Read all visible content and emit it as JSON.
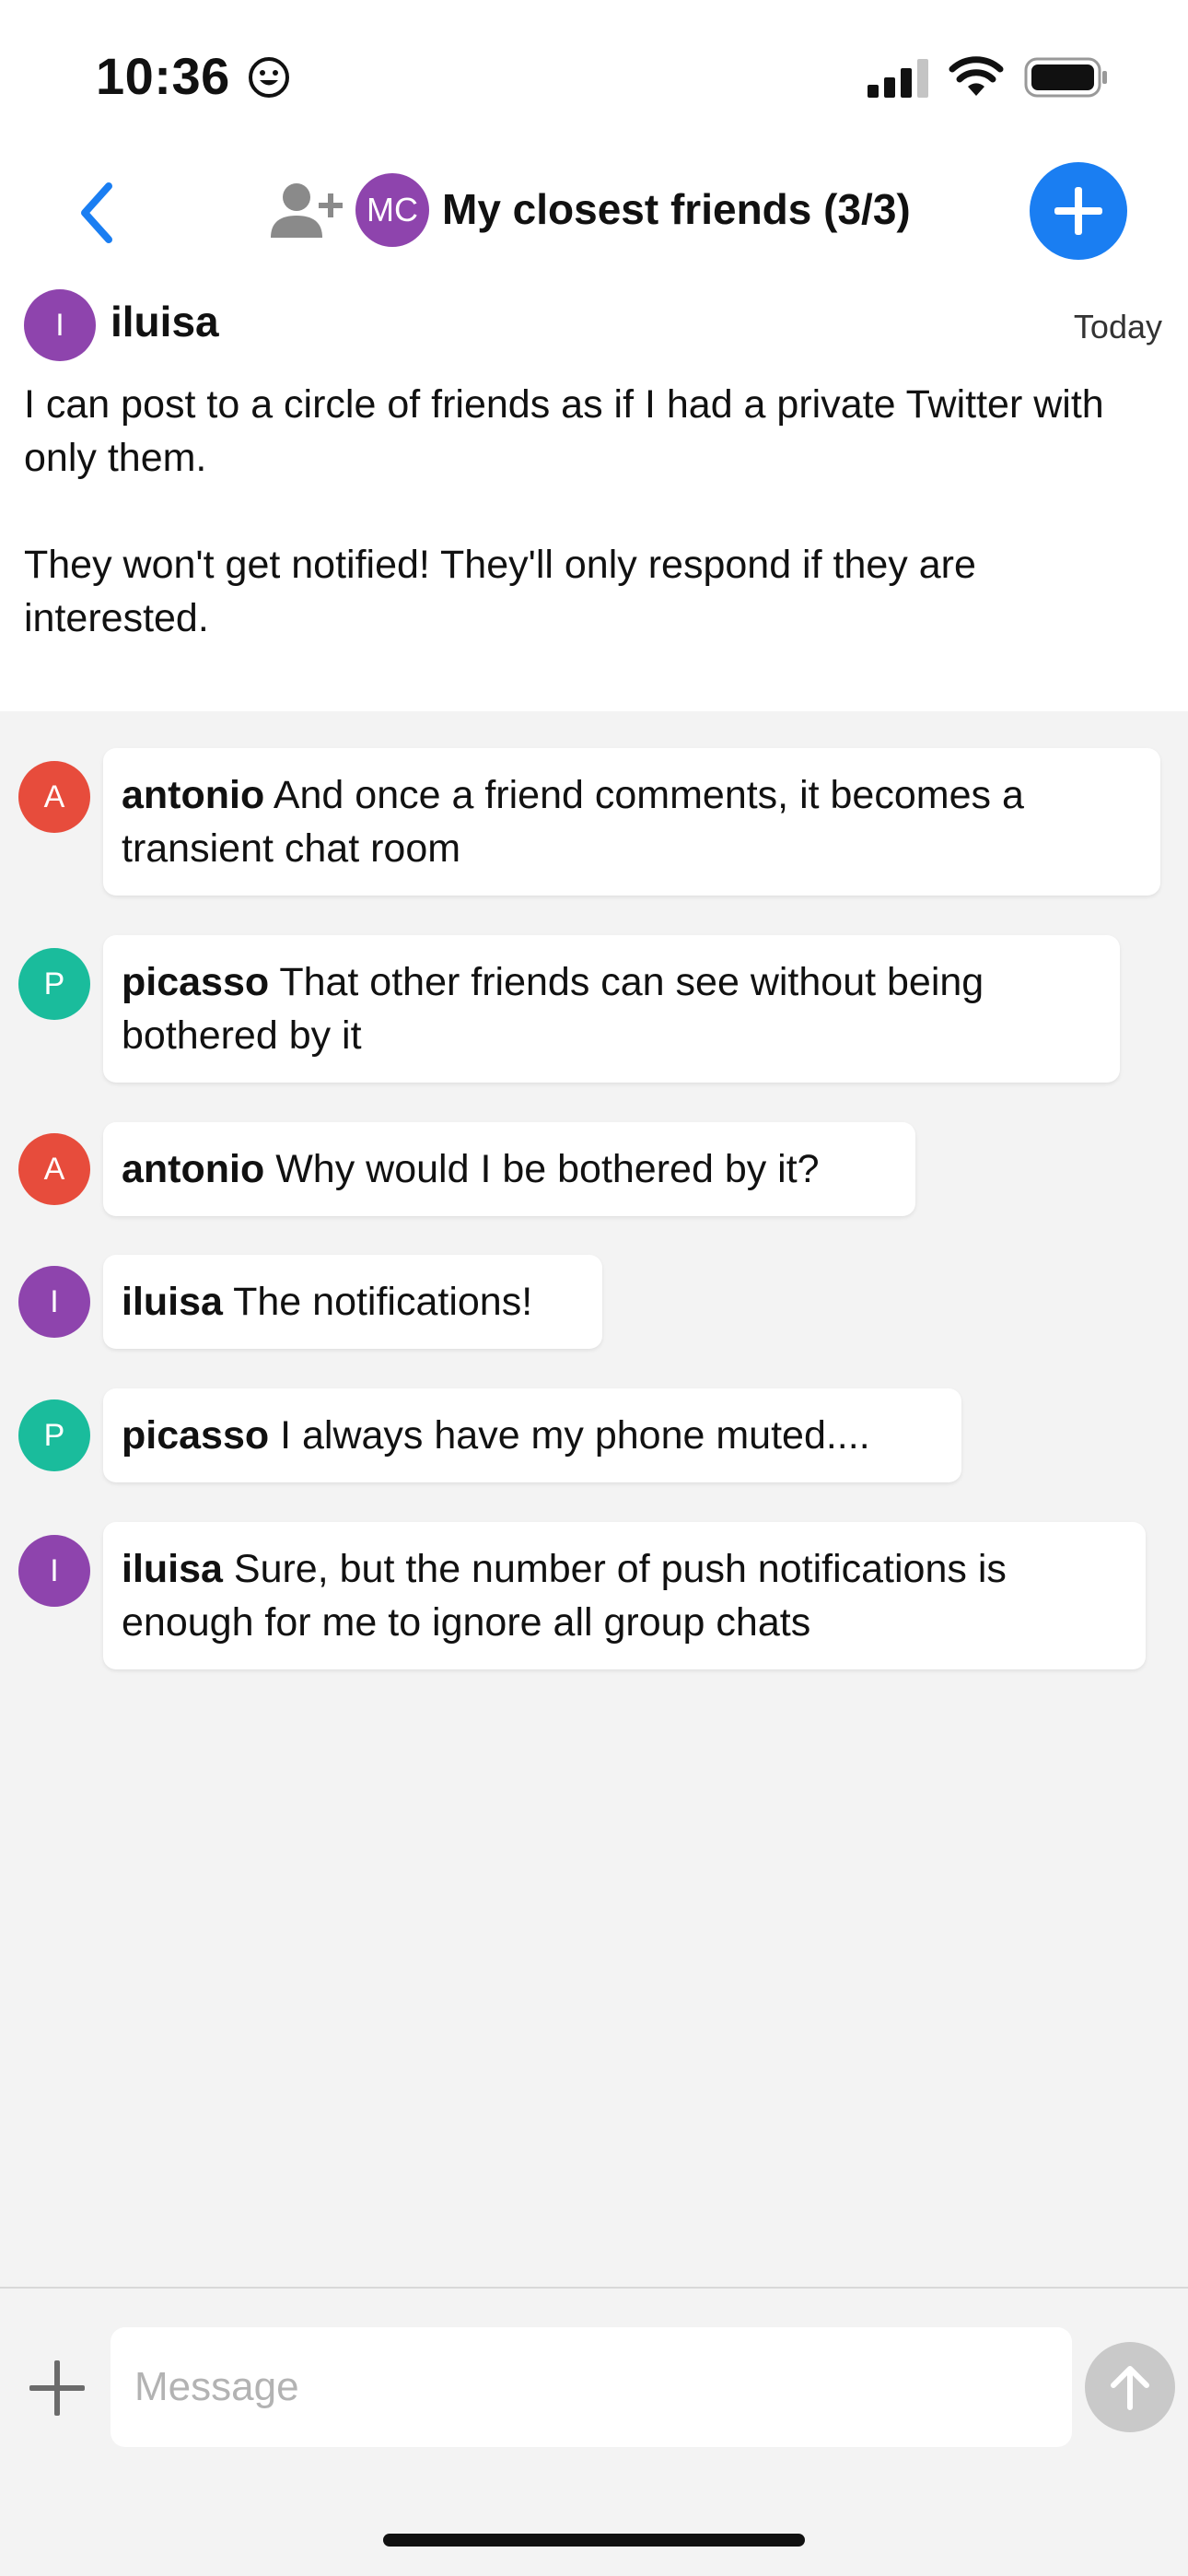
{
  "status_bar": {
    "time": "10:36"
  },
  "header": {
    "group_initials": "MC",
    "title": "My closest friends (3/3)"
  },
  "post": {
    "avatar_initial": "I",
    "author": "iluisa",
    "date": "Today",
    "paragraphs": [
      "I can post to a circle of friends as if I had a private Twitter with only them.",
      "They won't get notified! They'll only respond if they are interested."
    ]
  },
  "comments": [
    {
      "initial": "A",
      "author": "antonio",
      "text": "And once a friend comments, it becomes a transient chat room",
      "color": "#e74c3c"
    },
    {
      "initial": "P",
      "author": "picasso",
      "text": "That other friends can see without being bothered by it",
      "color": "#1abc9c"
    },
    {
      "initial": "A",
      "author": "antonio",
      "text": "Why would I be bothered by it?",
      "color": "#e74c3c"
    },
    {
      "initial": "I",
      "author": "iluisa",
      "text": "The notifications!",
      "color": "#8e44ad"
    },
    {
      "initial": "P",
      "author": "picasso",
      "text": "I always have my phone muted....",
      "color": "#1abc9c"
    },
    {
      "initial": "I",
      "author": "iluisa",
      "text": "Sure, but the number of push notifications is enough for me to ignore all group chats",
      "color": "#8e44ad"
    }
  ],
  "composer": {
    "placeholder": "Message"
  },
  "colors": {
    "accent": "#1a7ef2",
    "background": "#f3f3f3"
  }
}
